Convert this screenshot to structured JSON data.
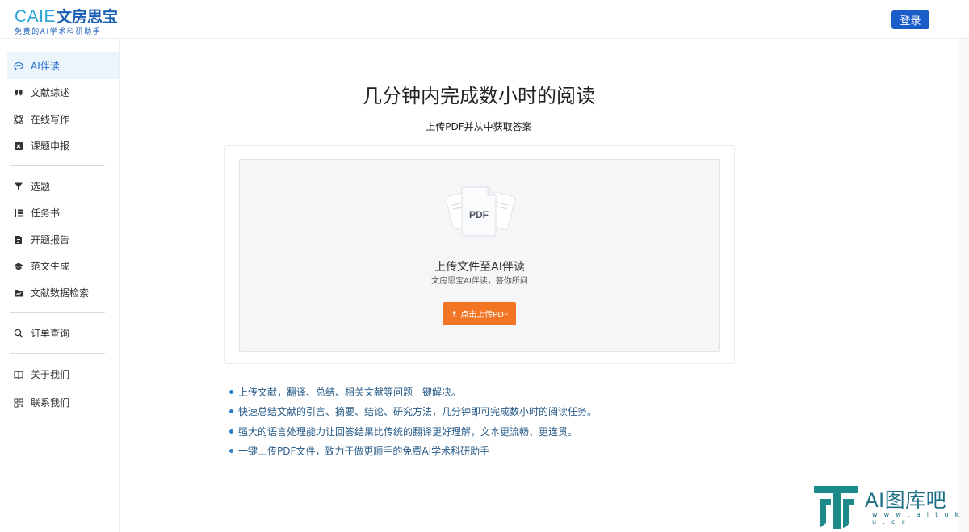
{
  "header": {
    "logo_en": "CAIE",
    "logo_cn": "文房思宝",
    "logo_sub": "免费的AI学术科研助手",
    "login_label": "登录"
  },
  "sidebar": {
    "items": [
      {
        "label": "AI伴读",
        "icon": "chat-icon",
        "active": true
      },
      {
        "label": "文献综述",
        "icon": "quote-icon"
      },
      {
        "label": "在线写作",
        "icon": "nodes-icon"
      },
      {
        "label": "课题申报",
        "icon": "x-box-icon"
      },
      {
        "label": "选题",
        "icon": "filter-icon"
      },
      {
        "label": "任务书",
        "icon": "list-icon"
      },
      {
        "label": "开题报告",
        "icon": "document-icon"
      },
      {
        "label": "范文生成",
        "icon": "graduation-cap-icon"
      },
      {
        "label": "文献数据检索",
        "icon": "folder-chart-icon"
      },
      {
        "label": "订单查询",
        "icon": "search-icon"
      },
      {
        "label": "关于我们",
        "icon": "book-icon"
      },
      {
        "label": "联系我们",
        "icon": "qrcode-icon"
      }
    ]
  },
  "main": {
    "title": "几分钟内完成数小时的阅读",
    "subtitle": "上传PDF并从中获取答案",
    "upload": {
      "icon_text": "PDF",
      "title": "上传文件至AI伴读",
      "description": "文房思宝AI伴读，答你所问",
      "button_label": "点击上传PDF"
    },
    "features": [
      "上传文献，翻译、总结、相关文献等问题一键解决。",
      "快速总结文献的引言、摘要、结论、研究方法，几分钟即可完成数小时的阅读任务。",
      "强大的语言处理能力让回答结果比传统的翻译更好理解，文本更流畅、更连贯。",
      "一键上传PDF文件，致力于做更顺手的免费AI学术科研助手"
    ]
  },
  "watermark": {
    "text": "AI图库吧",
    "url": "w w w . a i t u k u . c c"
  },
  "colors": {
    "primary": "#1a5cc8",
    "accent_orange": "#f27524",
    "active_bg": "#edf5fc",
    "feature_text": "#2a5d8a"
  }
}
